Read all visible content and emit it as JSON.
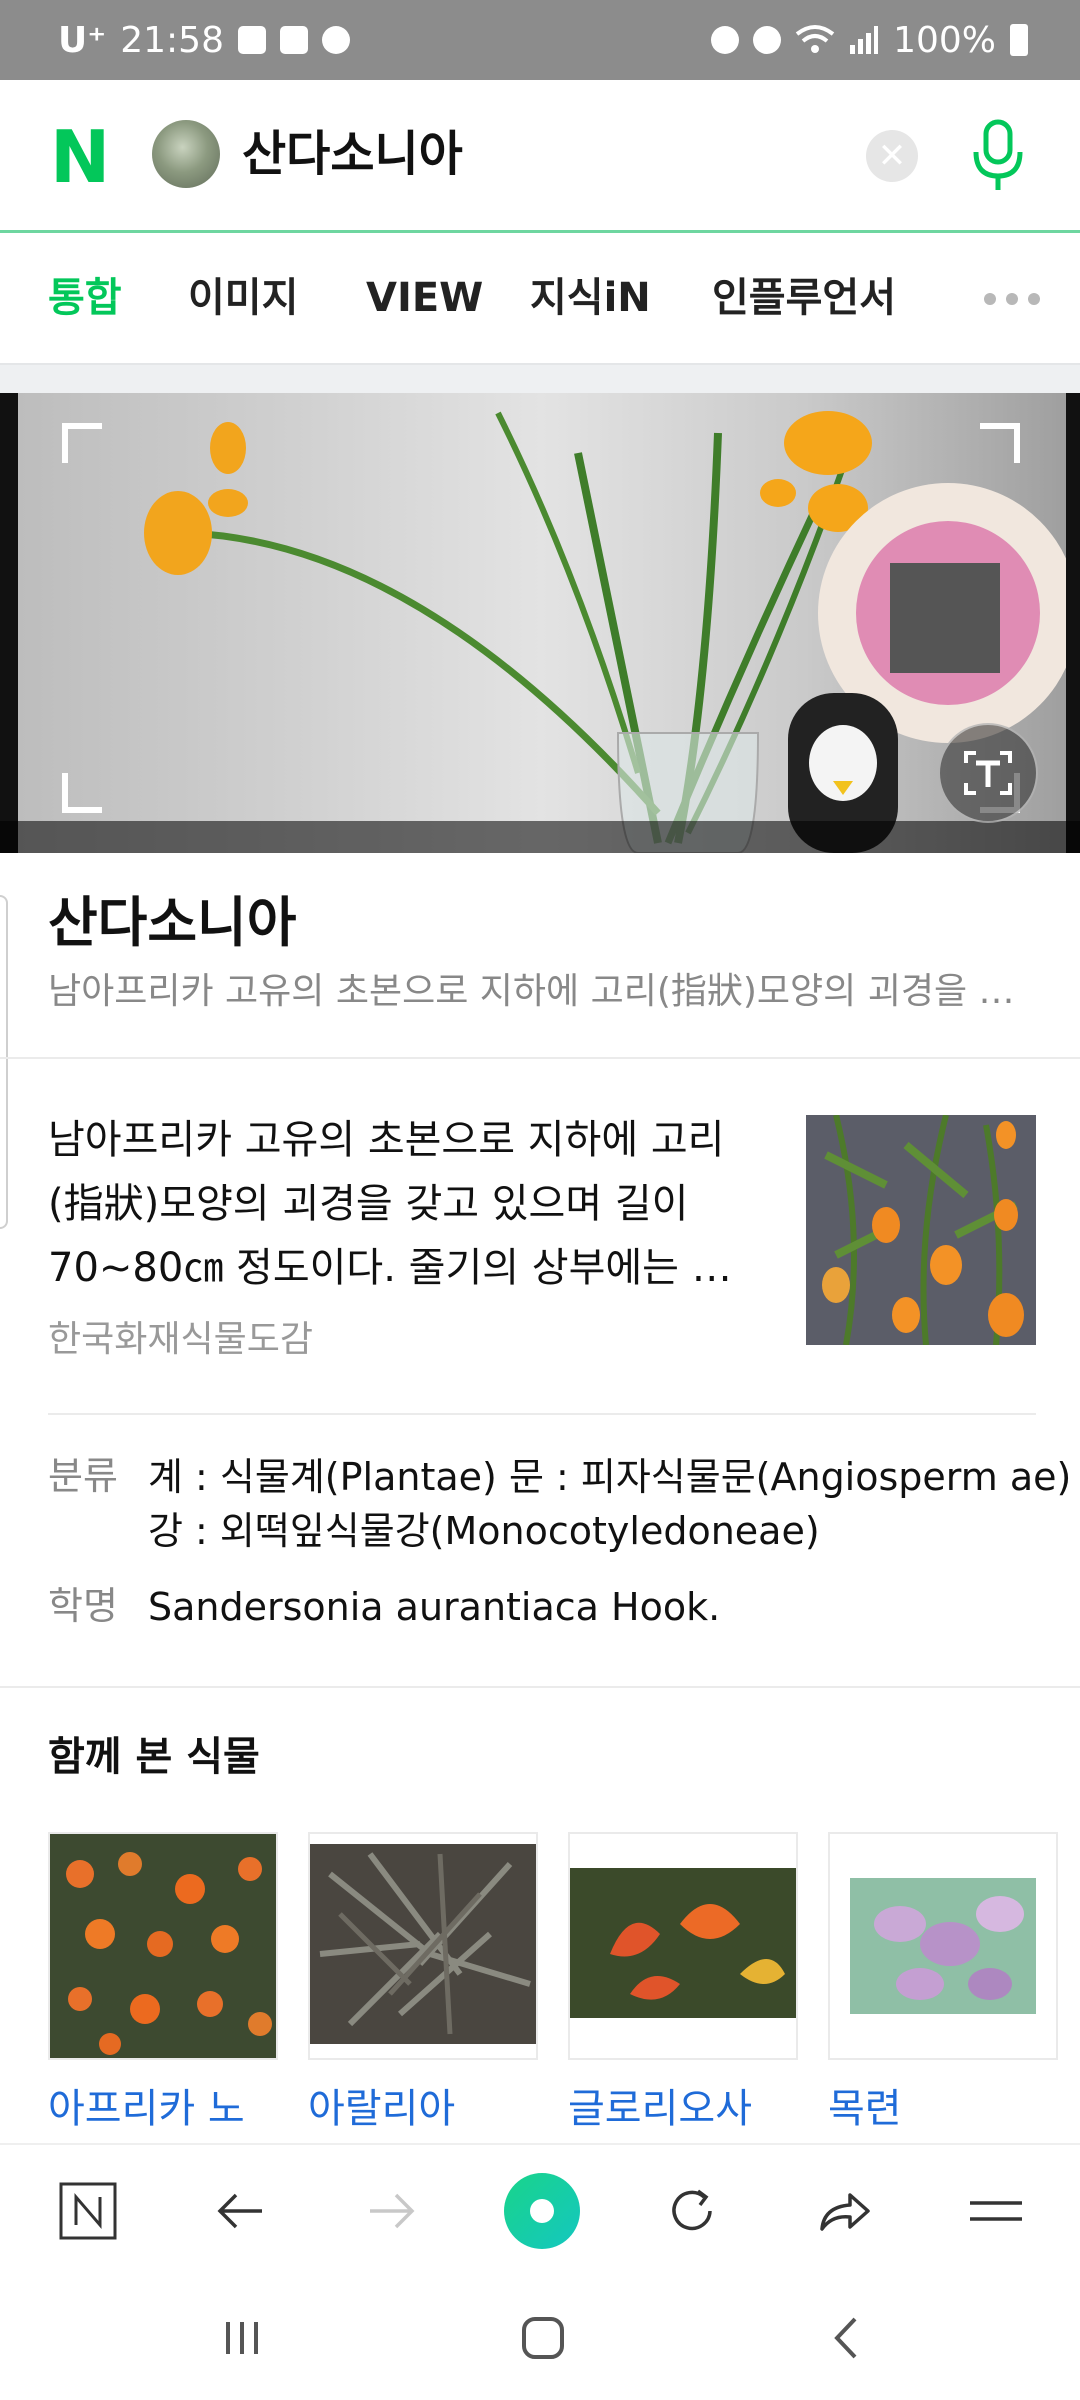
{
  "status_bar": {
    "carrier": "U⁺",
    "time": "21:58",
    "battery": "100%",
    "left_icons": [
      "notification-icon",
      "photo-icon",
      "shutter-icon"
    ],
    "right_icons": [
      "data-saver-icon",
      "alarm-icon",
      "wifi-icon",
      "signal-icon",
      "battery-icon"
    ]
  },
  "search": {
    "logo": "N",
    "query": "산다소니아"
  },
  "tabs": [
    {
      "label": "통합",
      "active": true
    },
    {
      "label": "이미지",
      "active": false
    },
    {
      "label": "VIEW",
      "active": false
    },
    {
      "label": "지식iN",
      "active": false
    },
    {
      "label": "인플루언서",
      "active": false
    }
  ],
  "result": {
    "title": "산다소니아",
    "subtitle": "남아프리카 고유의 초본으로 지하에 고리(指狀)모양의 괴경을 갖고 있으며",
    "description": "남아프리카 고유의 초본으로 지하에 고리(指狀)모양의 괴경을 갖고 있으며 길이 70~80㎝ 정도이다. 줄기의 상부에는 엽액에서",
    "source": "한국화재식물도감",
    "info": [
      {
        "label": "분류",
        "value": "계 : 식물계(Plantae) 문 : 피자식물문(Angiosperm ae) 강 : 외떡잎식물강(Monocotyledoneae)"
      },
      {
        "label": "학명",
        "value": "Sandersonia aurantiaca Hook."
      }
    ]
  },
  "related": {
    "title": "함께 본 식물",
    "items": [
      {
        "label": "아프리카 노"
      },
      {
        "label": "아랄리아"
      },
      {
        "label": "글로리오사"
      },
      {
        "label": "목련"
      }
    ]
  },
  "colors": {
    "brand": "#03c75a",
    "link": "#1f6bd8"
  }
}
